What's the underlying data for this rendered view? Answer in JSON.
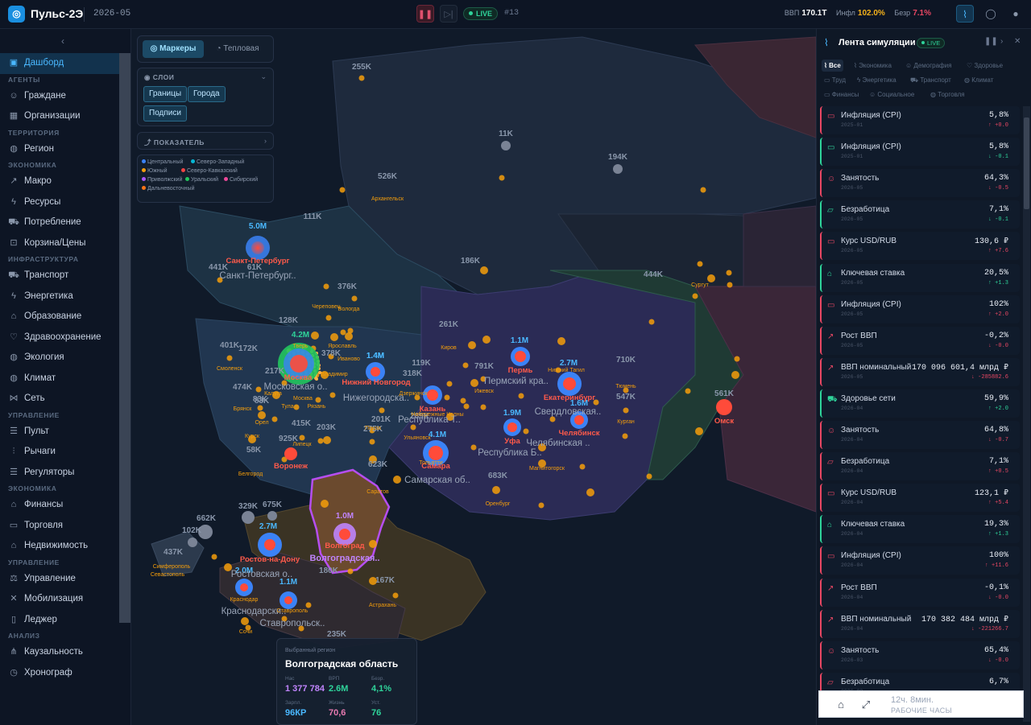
{
  "topbar": {
    "logo": "◎",
    "app_name": "Пульс-2Э",
    "period": "2026-05",
    "pause_icon": "pause-icon",
    "step_icon": "step-forward-icon",
    "live": "LIVE",
    "tick": "#13",
    "kpis": [
      {
        "label": "ВВП",
        "value": "170.1T",
        "color": "#ffffff"
      },
      {
        "label": "Инфл",
        "value": "102.0%",
        "color": "#f5b21b"
      },
      {
        "label": "Безр",
        "value": "7.1%",
        "color": "#e84763"
      }
    ]
  },
  "sidebar": {
    "collapse": "‹",
    "groups": [
      {
        "items": [
          {
            "label": "Дашборд",
            "icon": "dashboard-icon",
            "active": true
          }
        ]
      },
      {
        "title": "АГЕНТЫ",
        "items": [
          {
            "label": "Граждане",
            "icon": "user-icon"
          },
          {
            "label": "Организации",
            "icon": "building-icon"
          }
        ]
      },
      {
        "title": "ТЕРРИТОРИЯ",
        "items": [
          {
            "label": "Регион",
            "icon": "globe-icon"
          }
        ]
      },
      {
        "title": "ЭКОНОМИКА",
        "items": [
          {
            "label": "Макро",
            "icon": "trend-icon"
          },
          {
            "label": "Ресурсы",
            "icon": "bolt-icon"
          },
          {
            "label": "Потребление",
            "icon": "cart-icon"
          },
          {
            "label": "Корзина/Цены",
            "icon": "basket-icon"
          }
        ]
      },
      {
        "title": "ИНФРАСТРУКТУРА",
        "items": [
          {
            "label": "Транспорт",
            "icon": "truck-icon"
          },
          {
            "label": "Энергетика",
            "icon": "lightning-icon"
          },
          {
            "label": "Образование",
            "icon": "graduation-icon"
          },
          {
            "label": "Здравоохранение",
            "icon": "heart-icon"
          },
          {
            "label": "Экология",
            "icon": "globe-icon"
          },
          {
            "label": "Климат",
            "icon": "globe-icon"
          },
          {
            "label": "Сеть",
            "icon": "network-icon"
          }
        ]
      },
      {
        "title": "УПРАВЛЕНИЕ",
        "items": [
          {
            "label": "Пульт",
            "icon": "sliders-icon"
          },
          {
            "label": "Рычаги",
            "icon": "lever-icon"
          },
          {
            "label": "Регуляторы",
            "icon": "sliders-icon"
          }
        ]
      },
      {
        "title": "ЭКОНОМИКА",
        "items": [
          {
            "label": "Финансы",
            "icon": "bank-icon"
          },
          {
            "label": "Торговля",
            "icon": "briefcase-icon"
          },
          {
            "label": "Недвижимость",
            "icon": "house-icon"
          }
        ]
      },
      {
        "title": "УПРАВЛЕНИЕ",
        "items": [
          {
            "label": "Управление",
            "icon": "scale-icon"
          },
          {
            "label": "Мобилизация",
            "icon": "swords-icon"
          },
          {
            "label": "Леджер",
            "icon": "book-icon"
          }
        ]
      },
      {
        "title": "АНАЛИЗ",
        "items": [
          {
            "label": "Каузальность",
            "icon": "graph-icon"
          },
          {
            "label": "Хронограф",
            "icon": "clock-icon"
          }
        ]
      }
    ]
  },
  "map_controls": {
    "tab_markers": "Маркеры",
    "tab_heat": "Тепловая",
    "layers_title": "СЛОИ",
    "chips": [
      "Границы",
      "Города",
      "Подписи"
    ],
    "metric_title": "ПОКАЗАТЕЛЬ",
    "legend": [
      {
        "label": "Центральный",
        "color": "#3b82f6"
      },
      {
        "label": "Северо-Западный",
        "color": "#06b6d4"
      },
      {
        "label": "Южный",
        "color": "#f59e0b"
      },
      {
        "label": "Северо-Кавказский",
        "color": "#ef4444"
      },
      {
        "label": "Приволжский",
        "color": "#a855f7"
      },
      {
        "label": "Уральский",
        "color": "#22c55e"
      },
      {
        "label": "Сибирский",
        "color": "#ec4899"
      },
      {
        "label": "Дальневосточный",
        "color": "#f97316"
      }
    ]
  },
  "map": {
    "pop_labels": [
      "255K",
      "11K",
      "194K",
      "526K",
      "111K",
      "186K",
      "444K",
      "441K",
      "61K",
      "376K",
      "128K",
      "4.2M",
      "401K",
      "378K",
      "261K",
      "1.1M",
      "2.7M",
      "710K",
      "119K",
      "791K",
      "547K",
      "474K",
      "83K",
      "1.4M",
      "318K",
      "289K",
      "1.6M",
      "1.9M",
      "415K",
      "203K",
      "275K",
      "201K",
      "4.1M",
      "561K",
      "925K",
      "623K",
      "683K",
      "662K",
      "329K",
      "675K",
      "102K",
      "437K",
      "2.7M",
      "1.0M",
      "2.0M",
      "1.1M",
      "180K",
      "167K",
      "235K",
      "5.0M",
      "1.4M",
      "172K",
      "217K",
      "83K",
      "58K"
    ],
    "region_labels": [
      "Санкт-Петербург",
      "Москва",
      "Нижний Новгород",
      "Казань",
      "Пермь",
      "Екатеринбург",
      "Челябинск",
      "Уфа",
      "Самара",
      "Омск",
      "Воронеж",
      "Ростов-на-Дону",
      "Волгоградская..",
      "Волгоград"
    ],
    "subject_labels": [
      "Санкт-Петербург..",
      "Московская о..",
      "Нижегородска..",
      "Республика Т..",
      "Пермский кра..",
      "Свердловская..",
      "Челябинская ..",
      "Республика Б..",
      "Самарская об..",
      "Ростовская о..",
      "Краснодарски..",
      "Ставропольск.."
    ],
    "city_labels": [
      "Архангельск",
      "Сургут",
      "Череповец",
      "Вологда",
      "Тверь",
      "Ярославль",
      "Иваново",
      "Владимир",
      "Смоленск",
      "Калуга",
      "Тула",
      "Рязань",
      "Москва",
      "Брянск",
      "Орел",
      "Курск",
      "Белгород",
      "Липецк",
      "Пенза",
      "Саратов",
      "Ульяновск",
      "Тольятти",
      "Набережные Челны",
      "Ижевск",
      "Киров",
      "Нижний Тагил",
      "Тюмень",
      "Курган",
      "Магнитогорск",
      "Оренбург",
      "Астрахань",
      "Севастополь",
      "Симферополь",
      "Краснодар",
      "Ставрополь",
      "Сочи",
      "Дзержинск"
    ]
  },
  "selected_region": {
    "subtitle": "Выбранный регион",
    "title": "Волгоградская область",
    "stats": [
      {
        "label": "Нас",
        "value": "1 377 784",
        "color": "#c084fc"
      },
      {
        "label": "ВРП",
        "value": "2.6M",
        "color": "#2fd39a"
      },
      {
        "label": "Безр.",
        "value": "4,1%",
        "color": "#2fd39a"
      },
      {
        "label": "Зарпл.",
        "value": "96КР",
        "color": "#4ab8ff"
      },
      {
        "label": "Жизнь",
        "value": "70,6",
        "color": "#e879b0"
      },
      {
        "label": "Уст.",
        "value": "76",
        "color": "#2fd39a"
      }
    ]
  },
  "feed": {
    "title": "Лента симуляции",
    "live": "LIVE",
    "filters": [
      "Все",
      "Экономика",
      "Демография",
      "Здоровье",
      "Труд",
      "Энергетика",
      "Транспорт",
      "Климат",
      "Финансы",
      "Социальное",
      "Торговля"
    ],
    "items": [
      {
        "name": "Инфляция (CPI)",
        "date": "2025-01",
        "value": "5,8%",
        "change": "↑ +0.0",
        "up": true,
        "color": "#e84763",
        "icon": "wallet-icon"
      },
      {
        "name": "Инфляция (CPI)",
        "date": "2025-01",
        "value": "5,8%",
        "change": "↓ -0.1",
        "up": false,
        "color": "#2fd39a",
        "icon": "wallet-icon"
      },
      {
        "name": "Занятость",
        "date": "2026-05",
        "value": "64,3%",
        "change": "↓ -0.5",
        "up": false,
        "color": "#e84763",
        "icon": "people-icon"
      },
      {
        "name": "Безработица",
        "date": "2026-05",
        "value": "7,1%",
        "change": "↓ -0.1",
        "up": false,
        "color": "#2fd39a",
        "icon": "folder-icon"
      },
      {
        "name": "Курс USD/RUB",
        "date": "2026-05",
        "value": "130,6 ₽",
        "change": "↑ +7.6",
        "up": true,
        "color": "#e84763",
        "icon": "wallet-icon"
      },
      {
        "name": "Ключевая ставка",
        "date": "2026-05",
        "value": "20,5%",
        "change": "↑ +1.3",
        "up": true,
        "color": "#2fd39a",
        "icon": "bank-icon"
      },
      {
        "name": "Инфляция (CPI)",
        "date": "2026-05",
        "value": "102%",
        "change": "↑ +2.0",
        "up": true,
        "color": "#e84763",
        "icon": "wallet-icon"
      },
      {
        "name": "Рост ВВП",
        "date": "2026-05",
        "value": "-0,2%",
        "change": "↓ -0.0",
        "up": false,
        "color": "#e84763",
        "icon": "trend-icon"
      },
      {
        "name": "ВВП номинальный",
        "date": "2026-05",
        "value": "170 096 601,4 млрд ₽",
        "change": "↓ -285882.6",
        "up": false,
        "color": "#e84763",
        "icon": "trend-icon"
      },
      {
        "name": "Здоровье сети",
        "date": "2026-04",
        "value": "59,9%",
        "change": "↑ +2.0",
        "up": true,
        "color": "#2fd39a",
        "icon": "truck-icon"
      },
      {
        "name": "Занятость",
        "date": "2026-04",
        "value": "64,8%",
        "change": "↓ -0.7",
        "up": false,
        "color": "#e84763",
        "icon": "people-icon"
      },
      {
        "name": "Безработица",
        "date": "2026-04",
        "value": "7,1%",
        "change": "↑ +0.5",
        "up": true,
        "color": "#e84763",
        "icon": "folder-icon"
      },
      {
        "name": "Курс USD/RUB",
        "date": "2026-04",
        "value": "123,1 ₽",
        "change": "↑ +5.4",
        "up": true,
        "color": "#e84763",
        "icon": "wallet-icon"
      },
      {
        "name": "Ключевая ставка",
        "date": "2026-04",
        "value": "19,3%",
        "change": "↑ +1.3",
        "up": true,
        "color": "#2fd39a",
        "icon": "bank-icon"
      },
      {
        "name": "Инфляция (CPI)",
        "date": "2026-04",
        "value": "100%",
        "change": "↑ +11.6",
        "up": true,
        "color": "#e84763",
        "icon": "wallet-icon"
      },
      {
        "name": "Рост ВВП",
        "date": "2026-04",
        "value": "-0,1%",
        "change": "↓ -0.0",
        "up": false,
        "color": "#e84763",
        "icon": "trend-icon"
      },
      {
        "name": "ВВП номинальный",
        "date": "2026-04",
        "value": "170 382 484 млрд ₽",
        "change": "↓ -221266.7",
        "up": false,
        "color": "#e84763",
        "icon": "trend-icon"
      },
      {
        "name": "Занятость",
        "date": "2026-03",
        "value": "65,4%",
        "change": "↓ -0.0",
        "up": false,
        "color": "#e84763",
        "icon": "people-icon"
      },
      {
        "name": "Безработица",
        "date": "2026-03",
        "value": "6,7%",
        "change": "",
        "up": true,
        "color": "#e84763",
        "icon": "folder-icon"
      }
    ]
  },
  "clock": {
    "time": "12ч. 8мин.",
    "status": "РАБОЧИЕ ЧАСЫ"
  }
}
